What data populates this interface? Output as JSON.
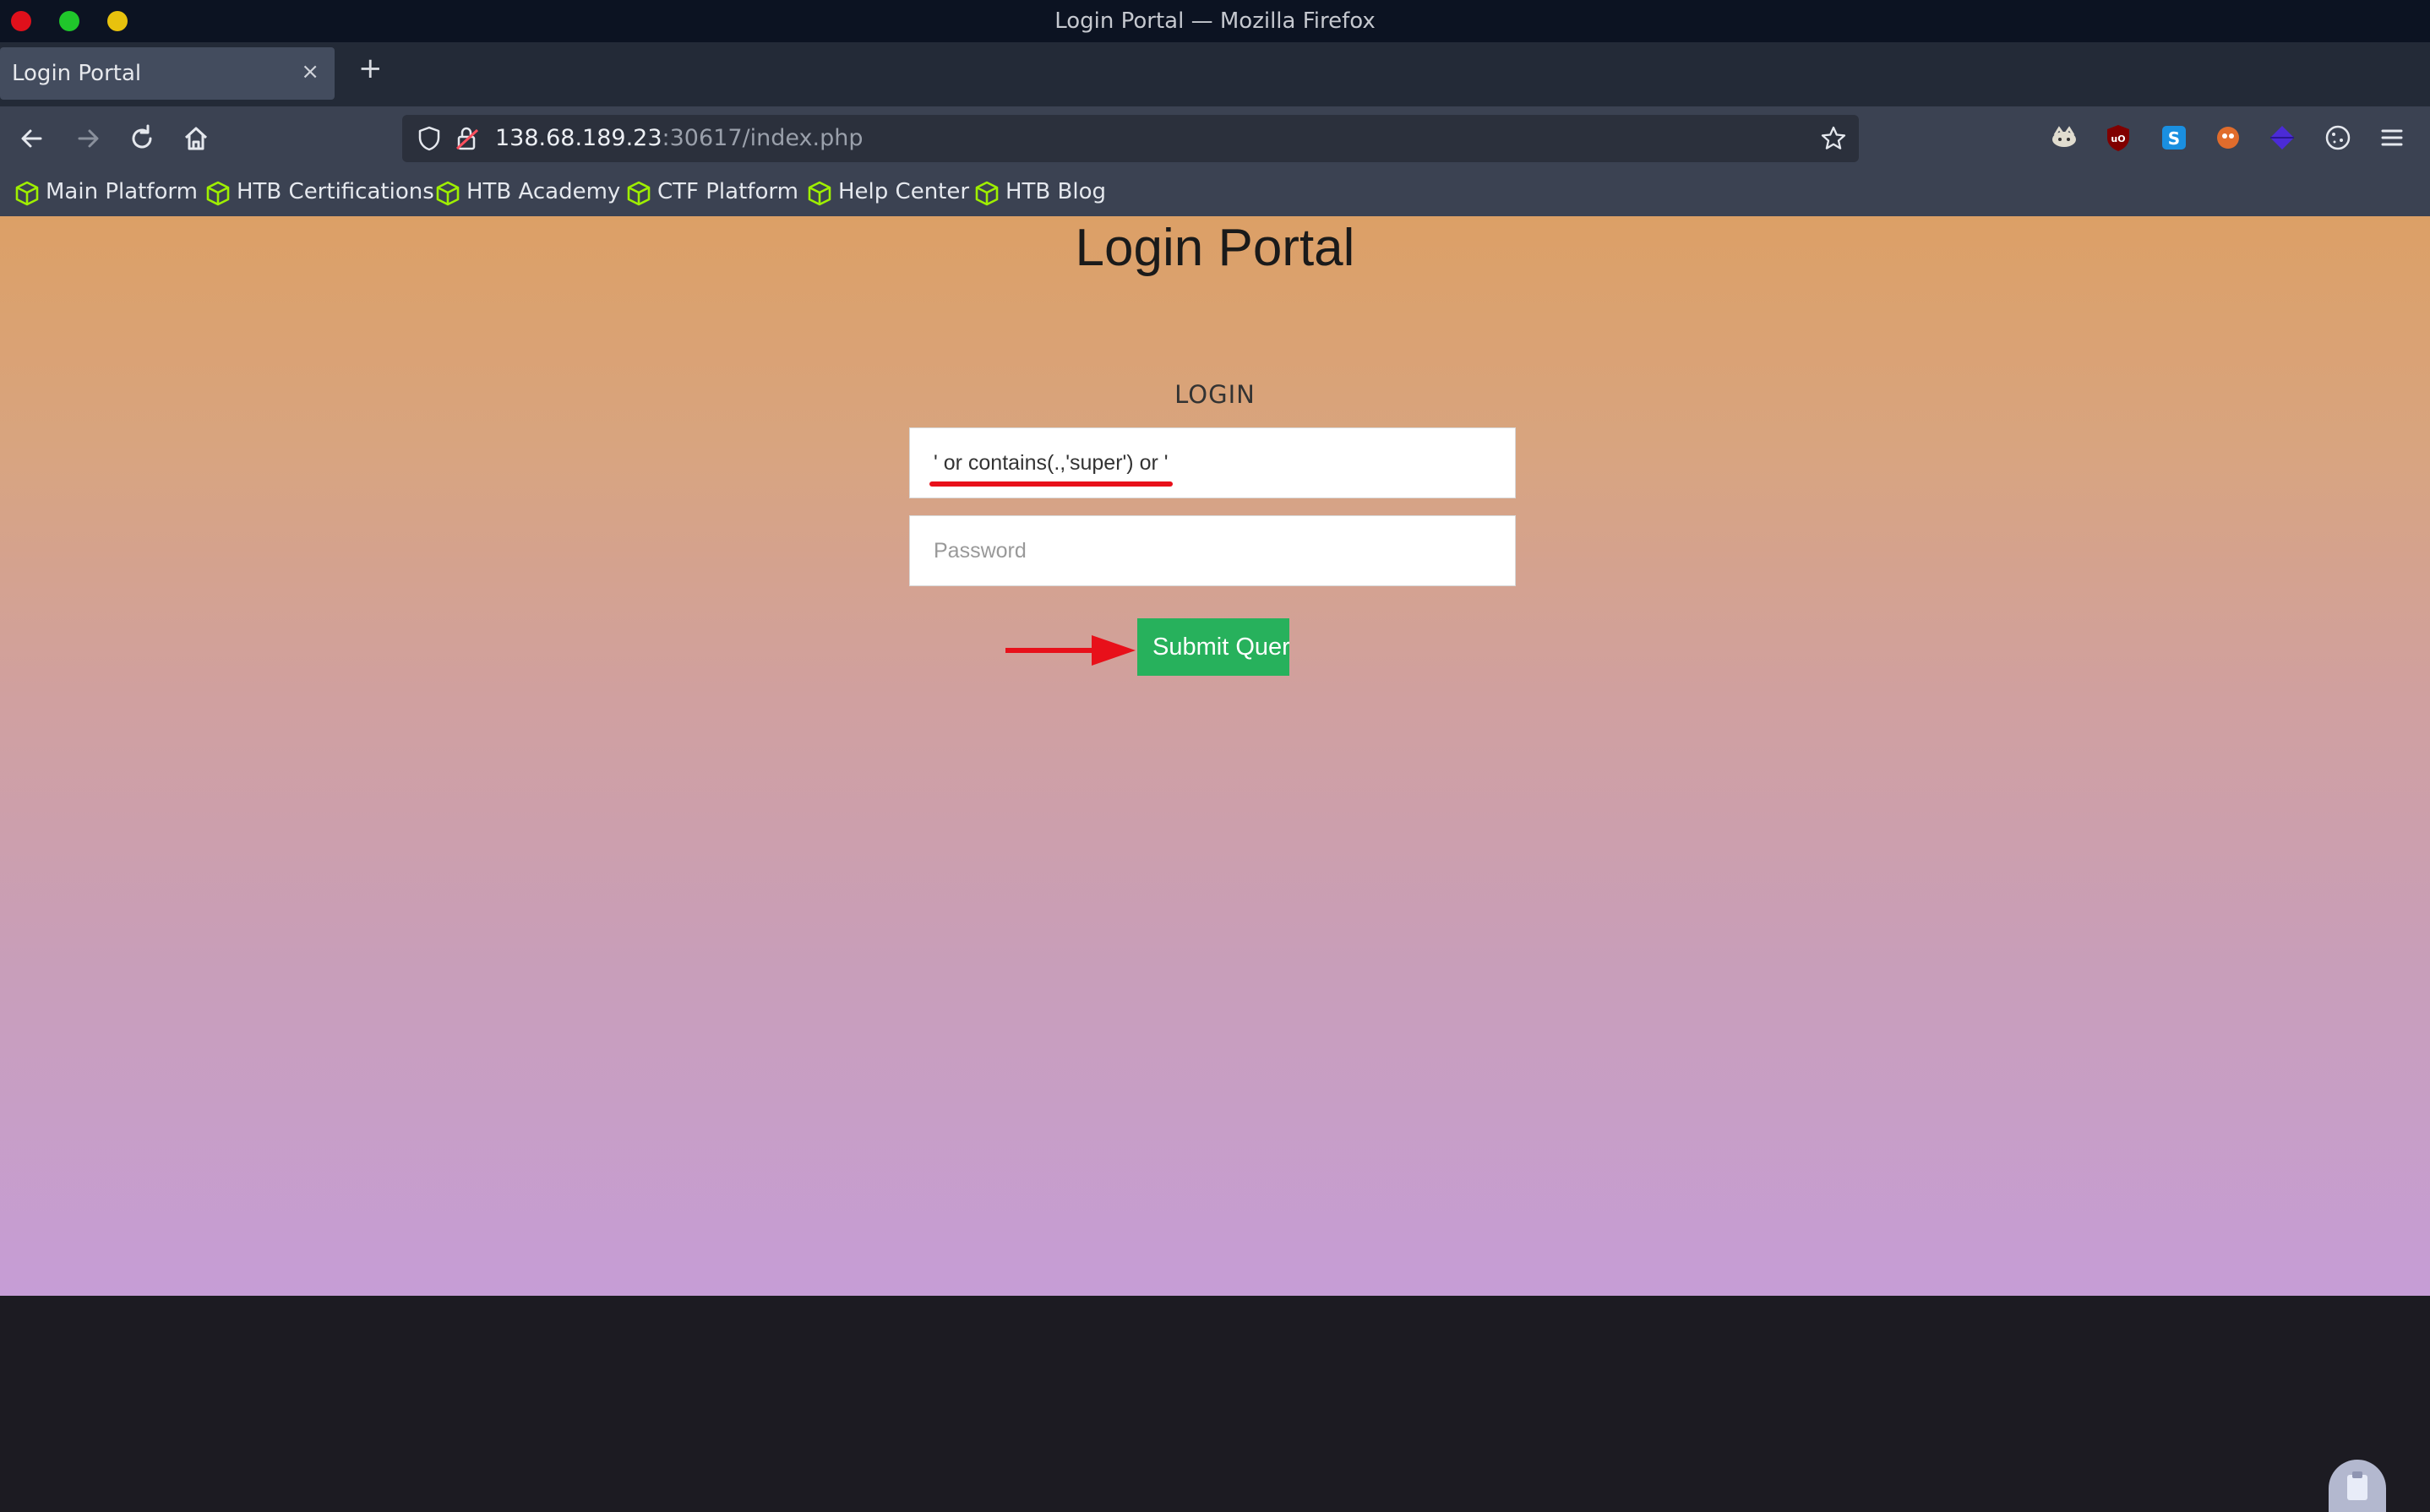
{
  "window": {
    "title": "Login Portal — Mozilla Firefox"
  },
  "tabs": [
    {
      "label": "Login Portal",
      "close": "×"
    }
  ],
  "new_tab": "+",
  "urlbar": {
    "host": "138.68.189.23",
    "rest": ":30617/index.php"
  },
  "bookmarks": [
    {
      "label": "Main Platform"
    },
    {
      "label": "HTB Certifications"
    },
    {
      "label": "HTB Academy"
    },
    {
      "label": "CTF Platform"
    },
    {
      "label": "Help Center"
    },
    {
      "label": "HTB Blog"
    }
  ],
  "page": {
    "title": "Login Portal",
    "login_heading": "LOGIN",
    "username_value": "' or contains(.,'super') or '",
    "password_placeholder": "Password",
    "submit_label": "Submit Query"
  },
  "colors": {
    "submit_button": "#27b15c",
    "annotation_red": "#e8101a",
    "bookmark_icon": "#9fef00"
  }
}
